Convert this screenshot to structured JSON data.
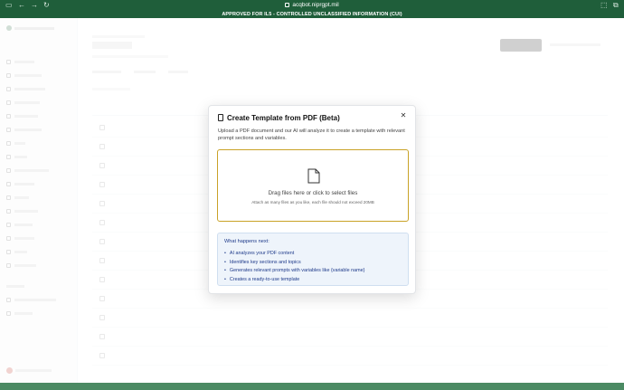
{
  "browser": {
    "url": "acqbot.niprgpt.mil",
    "back_icon": "arrow-left-icon",
    "forward_icon": "arrow-right-icon",
    "reload_icon": "reload-icon"
  },
  "banner": {
    "top_text": "APPROVED FOR IL5 - CONTROLLED UNCLASSIFIED INFORMATION (CUI)"
  },
  "modal": {
    "title": "Create Template from PDF (Beta)",
    "description": "Upload a PDF document and our AI will analyze it to create a template with relevant prompt sections and variables.",
    "dropzone": {
      "main_text": "Drag files here or click to select files",
      "sub_text": "Attach as many files as you like, each file should not exceed 20MB"
    },
    "info": {
      "title": "What happens next:",
      "items": [
        "AI analyzes your PDF content",
        "Identifies key sections and topics",
        "Generates relevant prompts with variables like {variable name}",
        "Creates a ready-to-use template"
      ]
    },
    "colors": {
      "dropzone_border": "#c9a227",
      "info_background": "#eef4fb",
      "info_text": "#1e3a8a",
      "banner": "#1f5e3a"
    }
  }
}
